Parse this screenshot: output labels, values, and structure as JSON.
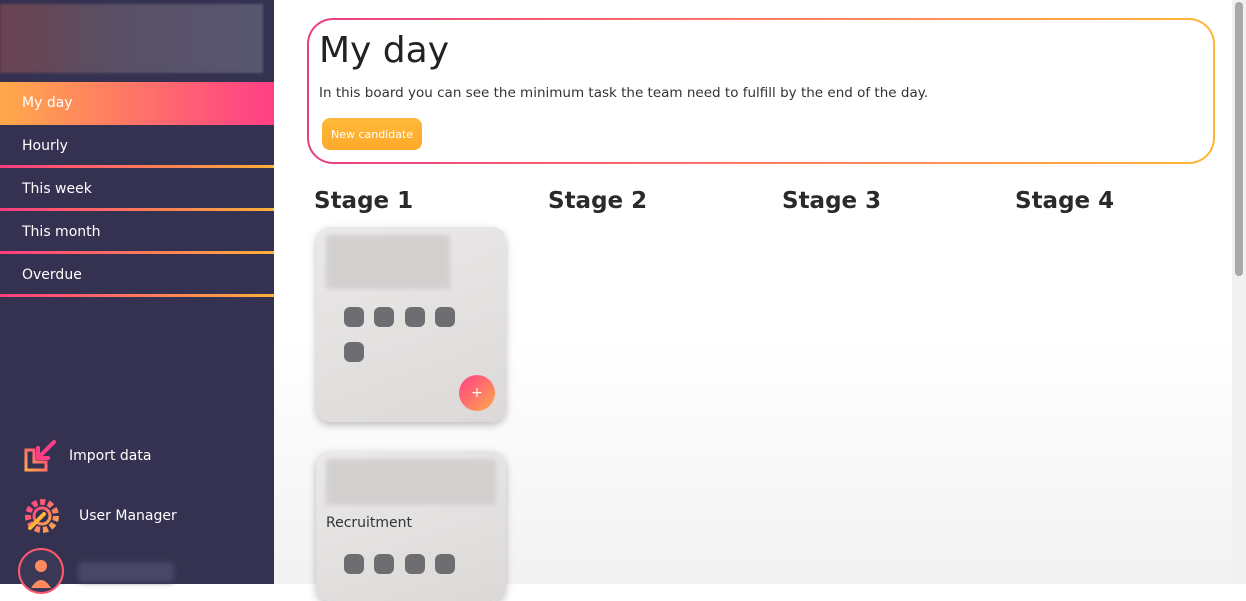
{
  "sidebar": {
    "nav": [
      {
        "label": "My day",
        "active": true
      },
      {
        "label": "Hourly",
        "active": false
      },
      {
        "label": "This week",
        "active": false
      },
      {
        "label": "This month",
        "active": false
      },
      {
        "label": "Overdue",
        "active": false
      }
    ],
    "actions": {
      "import_label": "Import data",
      "user_manager_label": "User Manager"
    }
  },
  "hero": {
    "title": "My day",
    "description": "In this board you can see the minimum task the team need to fulfill by the end of the day.",
    "button_label": "New candidate"
  },
  "stages": [
    "Stage 1",
    "Stage 2",
    "Stage 3",
    "Stage 4"
  ],
  "cards": [
    {
      "tag": "",
      "plus_label": "+"
    },
    {
      "tag": "Recruitment"
    }
  ],
  "colors": {
    "sidebar_bg": "#343250",
    "accent_pink": "#ff3e86",
    "accent_orange": "#ffa94a",
    "accent_yellow": "#ffb637"
  }
}
